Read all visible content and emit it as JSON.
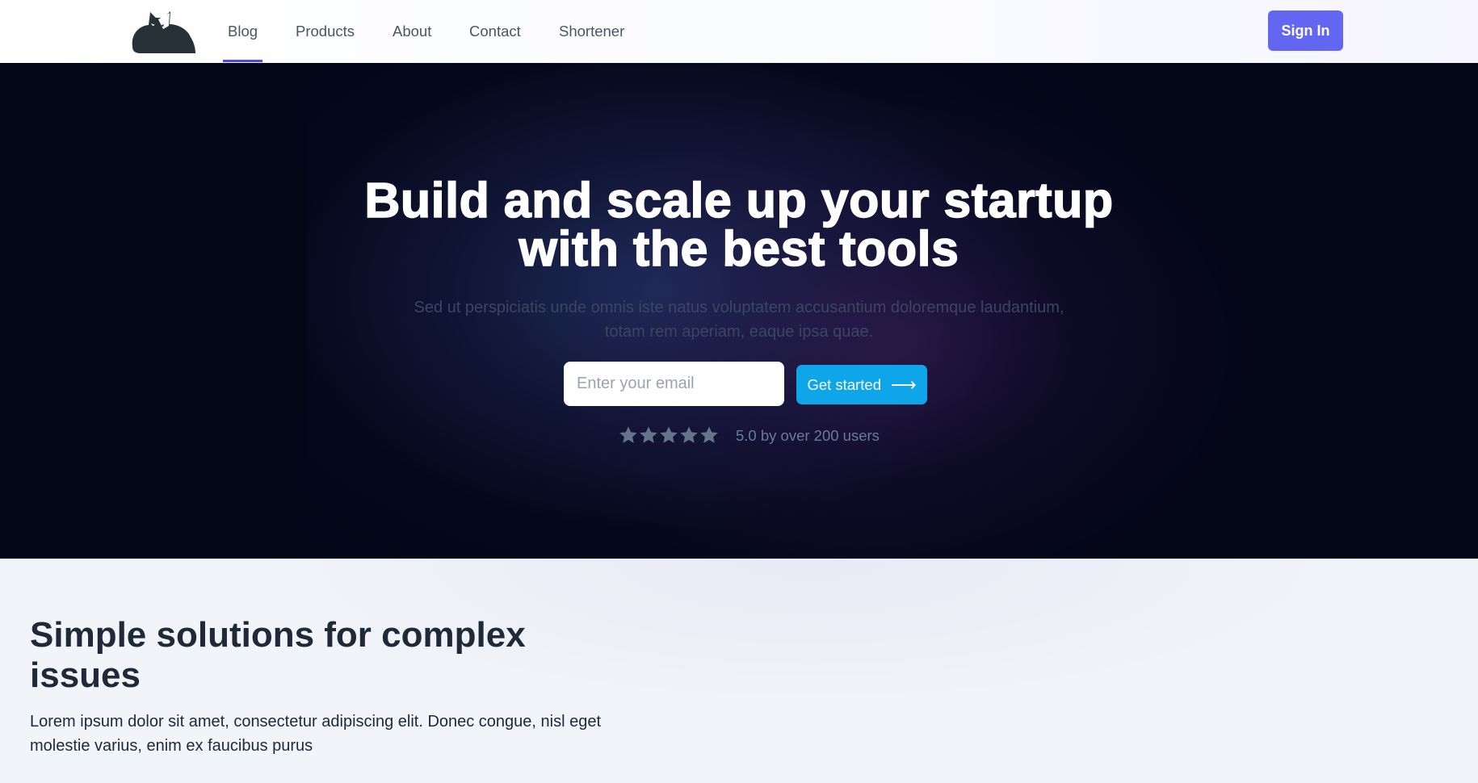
{
  "nav": {
    "links": [
      "Blog",
      "Products",
      "About",
      "Contact",
      "Shortener"
    ],
    "active": "Blog",
    "sign_in": "Sign In"
  },
  "hero": {
    "title_line1": "Build and scale up your startup",
    "title_line2": "with the best tools",
    "subtitle_line1": "Sed ut perspiciatis unde omnis iste natus voluptatem accusantium doloremque laudantium,",
    "subtitle_line2": "totam rem aperiam, eaque ipsa quae.",
    "email_placeholder": "Enter your email",
    "cta_label": "Get started",
    "cta_arrow": "⟶",
    "rating_stars": 5,
    "rating_text": "5.0 by over 200 users"
  },
  "section": {
    "title": "Simple solutions for complex issues",
    "text": "Lorem ipsum dolor sit amet, consectetur adipiscing elit. Donec congue, nisl eget molestie varius, enim ex faucibus purus"
  },
  "colors": {
    "accent": "#6366f1",
    "cta": "#0ea5e9",
    "hero_bg": "#030617",
    "star": "#64748b"
  }
}
